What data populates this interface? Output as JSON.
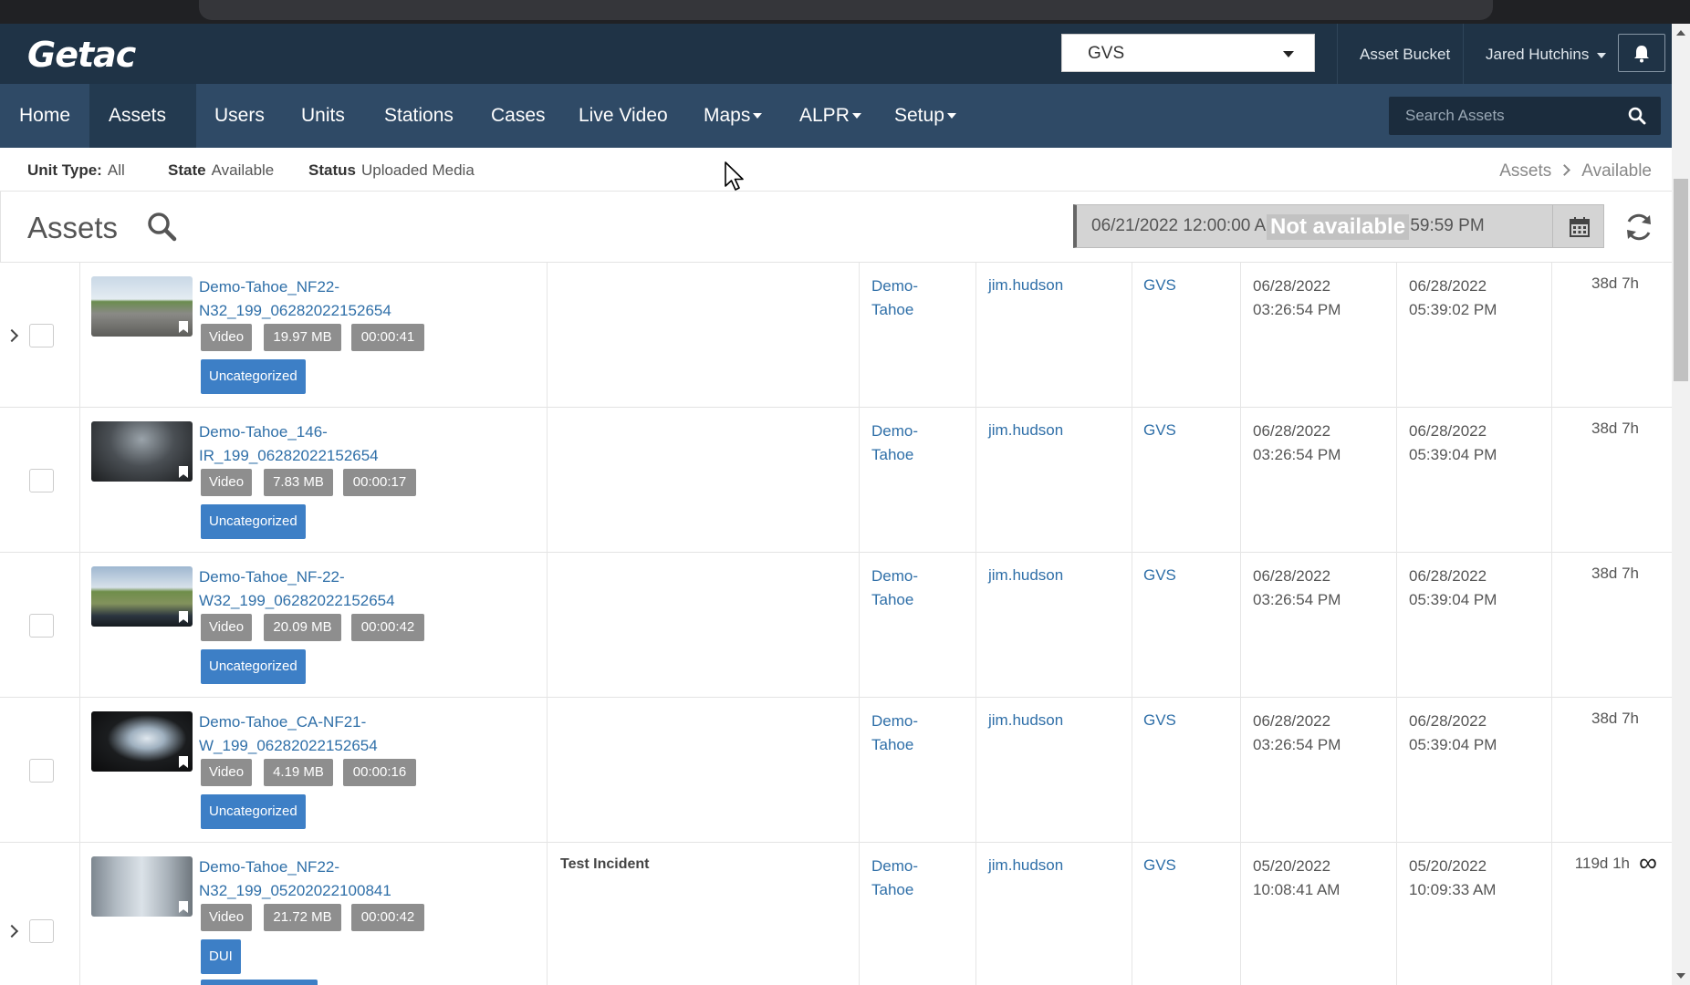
{
  "header": {
    "logo": "Getac",
    "agency_select": "GVS",
    "asset_bucket": "Asset Bucket",
    "user_name": "Jared Hutchins"
  },
  "nav": {
    "items": [
      {
        "label": "Home"
      },
      {
        "label": "Assets",
        "active": true,
        "dropdown": true
      },
      {
        "label": "Users"
      },
      {
        "label": "Units"
      },
      {
        "label": "Stations"
      },
      {
        "label": "Cases"
      },
      {
        "label": "Live Video"
      },
      {
        "label": "Maps",
        "dropdown": true
      },
      {
        "label": "ALPR",
        "dropdown": true
      },
      {
        "label": "Setup",
        "dropdown": true
      }
    ],
    "search_placeholder": "Search Assets"
  },
  "filters": {
    "unit_type_label": "Unit Type:",
    "unit_type_value": "All",
    "state_label": "State",
    "state_value": "Available",
    "status_label": "Status",
    "status_value": "Uploaded Media"
  },
  "breadcrumb": {
    "root": "Assets",
    "current": "Available"
  },
  "assets_panel": {
    "title": "Assets",
    "date_range": "06/21/2022 12:00:00 AM - 06/28/2022 11:59:59 PM",
    "date_overlay": "Not available"
  },
  "rows": [
    {
      "name_line1": "Demo-Tahoe_NF22-",
      "name_line2": "N32_199_06282022152654",
      "type": "Video",
      "size": "19.97 MB",
      "duration": "00:00:41",
      "category": "Uncategorized",
      "incident": "",
      "unit_line1": "Demo-",
      "unit_line2": "Tahoe",
      "user": "jim.hudson",
      "agency": "GVS",
      "start_date": "06/28/2022",
      "start_time": "03:26:54 PM",
      "upload_date": "06/28/2022",
      "upload_time": "05:39:02 PM",
      "retention": "38d 7h"
    },
    {
      "name_line1": "Demo-Tahoe_146-",
      "name_line2": "IR_199_06282022152654",
      "type": "Video",
      "size": "7.83 MB",
      "duration": "00:00:17",
      "category": "Uncategorized",
      "incident": "",
      "unit_line1": "Demo-",
      "unit_line2": "Tahoe",
      "user": "jim.hudson",
      "agency": "GVS",
      "start_date": "06/28/2022",
      "start_time": "03:26:54 PM",
      "upload_date": "06/28/2022",
      "upload_time": "05:39:04 PM",
      "retention": "38d 7h"
    },
    {
      "name_line1": "Demo-Tahoe_NF-22-",
      "name_line2": "W32_199_06282022152654",
      "type": "Video",
      "size": "20.09 MB",
      "duration": "00:00:42",
      "category": "Uncategorized",
      "incident": "",
      "unit_line1": "Demo-",
      "unit_line2": "Tahoe",
      "user": "jim.hudson",
      "agency": "GVS",
      "start_date": "06/28/2022",
      "start_time": "03:26:54 PM",
      "upload_date": "06/28/2022",
      "upload_time": "05:39:04 PM",
      "retention": "38d 7h"
    },
    {
      "name_line1": "Demo-Tahoe_CA-NF21-",
      "name_line2": "W_199_06282022152654",
      "type": "Video",
      "size": "4.19 MB",
      "duration": "00:00:16",
      "category": "Uncategorized",
      "incident": "",
      "unit_line1": "Demo-",
      "unit_line2": "Tahoe",
      "user": "jim.hudson",
      "agency": "GVS",
      "start_date": "06/28/2022",
      "start_time": "03:26:54 PM",
      "upload_date": "06/28/2022",
      "upload_time": "05:39:04 PM",
      "retention": "38d 7h"
    },
    {
      "name_line1": "Demo-Tahoe_NF22-",
      "name_line2": "N32_199_05202022100841",
      "type": "Video",
      "size": "21.72 MB",
      "duration": "00:00:42",
      "category": "DUI",
      "incident": "Test Incident",
      "unit_line1": "Demo-",
      "unit_line2": "Tahoe",
      "user": "jim.hudson",
      "agency": "GVS",
      "start_date": "05/20/2022",
      "start_time": "10:08:41 AM",
      "upload_date": "05/20/2022",
      "upload_time": "10:09:33 AM",
      "retention": "119d 1h",
      "infinity": "∞"
    }
  ],
  "colors": {
    "header_bg": "#1f3346",
    "nav_bg": "#2f4a66",
    "link": "#2f6fa8",
    "category_badge": "#3d7fc6",
    "tag_badge": "#8e8e8e"
  }
}
